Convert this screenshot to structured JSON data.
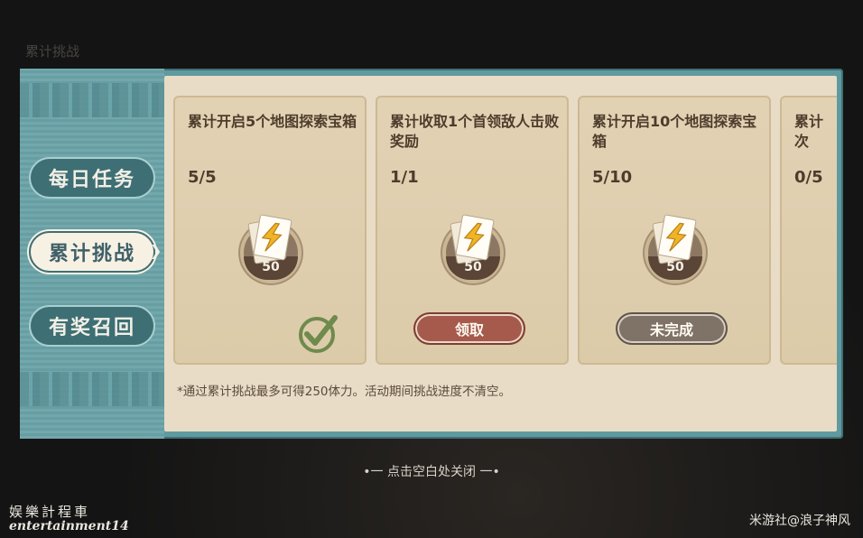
{
  "background": {
    "title_partial": "累计挑战"
  },
  "sidebar": {
    "items": [
      {
        "label": "每日任务",
        "active": false
      },
      {
        "label": "累计挑战",
        "active": true
      },
      {
        "label": "有奖召回",
        "active": false
      }
    ],
    "active_arrow": "❯"
  },
  "cards": [
    {
      "title": "累计开启5个地图探索宝箱",
      "progress": "5/5",
      "reward_icon": "stamina-card-icon",
      "reward_count": "50",
      "state": "claimed"
    },
    {
      "title": "累计收取1个首领敌人击败奖励",
      "progress": "1/1",
      "reward_icon": "stamina-card-icon",
      "reward_count": "50",
      "state": "claimable",
      "button_label": "领取"
    },
    {
      "title": "累计开启10个地图探索宝箱",
      "progress": "5/10",
      "reward_icon": "stamina-card-icon",
      "reward_count": "50",
      "state": "incomplete",
      "button_label": "未完成"
    },
    {
      "title": "累计次",
      "progress": "0/5",
      "state": "partial"
    }
  ],
  "note": "*通过累计挑战最多可得250体力。活动期间挑战进度不清空。",
  "close_hint": "•一 点击空白处关闭 一•",
  "watermark_left": {
    "line1": "娱樂計程車",
    "line2": "entertainment14"
  },
  "watermark_right": "米游社@浪子神风",
  "colors": {
    "panel_teal": "#5f9aa0",
    "parchment": "#e8dcc6",
    "claim_button": "#a55a4c",
    "pending_button": "#7f7368",
    "check_green": "#6f8a4d"
  }
}
